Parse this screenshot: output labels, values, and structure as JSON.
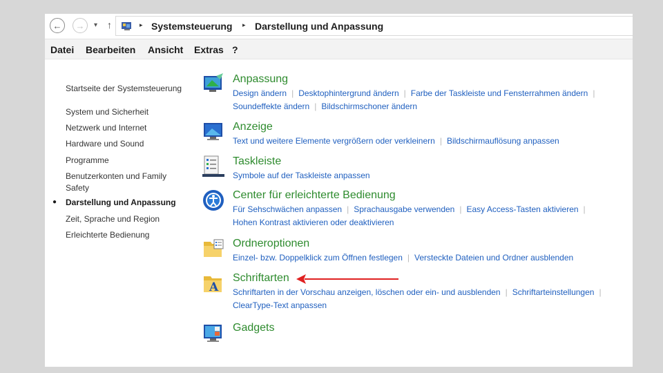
{
  "address": {
    "crumbs": [
      "Systemsteuerung",
      "Darstellung und Anpassung"
    ]
  },
  "menubar": {
    "items": [
      "Datei",
      "Bearbeiten",
      "Ansicht",
      "Extras",
      "?"
    ]
  },
  "sidebar": {
    "home": "Startseite der Systemsteuerung",
    "items": [
      "System und Sicherheit",
      "Netzwerk und Internet",
      "Hardware und Sound",
      "Programme",
      "Benutzerkonten und Family",
      "Safety",
      "Darstellung und Anpassung",
      "Zeit, Sprache und Region",
      "Erleichterte Bedienung"
    ]
  },
  "categories": [
    {
      "title": "Anpassung",
      "line1": [
        "Design ändern",
        "Desktophintergrund ändern",
        "Farbe der Taskleiste und Fensterrahmen ändern"
      ],
      "line2": [
        "Soundeffekte ändern",
        "Bildschirmschoner ändern"
      ]
    },
    {
      "title": "Anzeige",
      "line1": [
        "Text und weitere Elemente vergrößern oder verkleinern",
        "Bildschirmauflösung anpassen"
      ]
    },
    {
      "title": "Taskleiste",
      "line1": [
        "Symbole auf der Taskleiste anpassen"
      ]
    },
    {
      "title": "Center für erleichterte Bedienung",
      "line1": [
        "Für Sehschwächen anpassen",
        "Sprachausgabe verwenden",
        "Easy Access-Tasten aktivieren"
      ],
      "line2": [
        "Hohen Kontrast aktivieren oder deaktivieren"
      ]
    },
    {
      "title": "Ordneroptionen",
      "line1": [
        "Einzel- bzw. Doppelklick zum Öffnen festlegen",
        "Versteckte Dateien und Ordner ausblenden"
      ]
    },
    {
      "title": "Schriftarten",
      "line1": [
        "Schriftarten in der Vorschau anzeigen, löschen oder ein- und ausblenden",
        "Schriftarteinstellungen"
      ],
      "line2": [
        "ClearType-Text anpassen"
      ]
    },
    {
      "title": "Gadgets"
    }
  ],
  "colors": {
    "title_green": "#2e8b2e",
    "link_blue": "#1f5fbf",
    "arrow_red": "#e02020"
  },
  "icons": [
    "back-arrow-icon",
    "forward-arrow-icon",
    "up-arrow-icon",
    "control-panel-icon",
    "anpassung-icon",
    "anzeige-icon",
    "taskleiste-icon",
    "erleichterte-bedienung-icon",
    "ordneroptionen-icon",
    "schriftarten-icon",
    "gadgets-icon",
    "red-arrow-annotation"
  ]
}
